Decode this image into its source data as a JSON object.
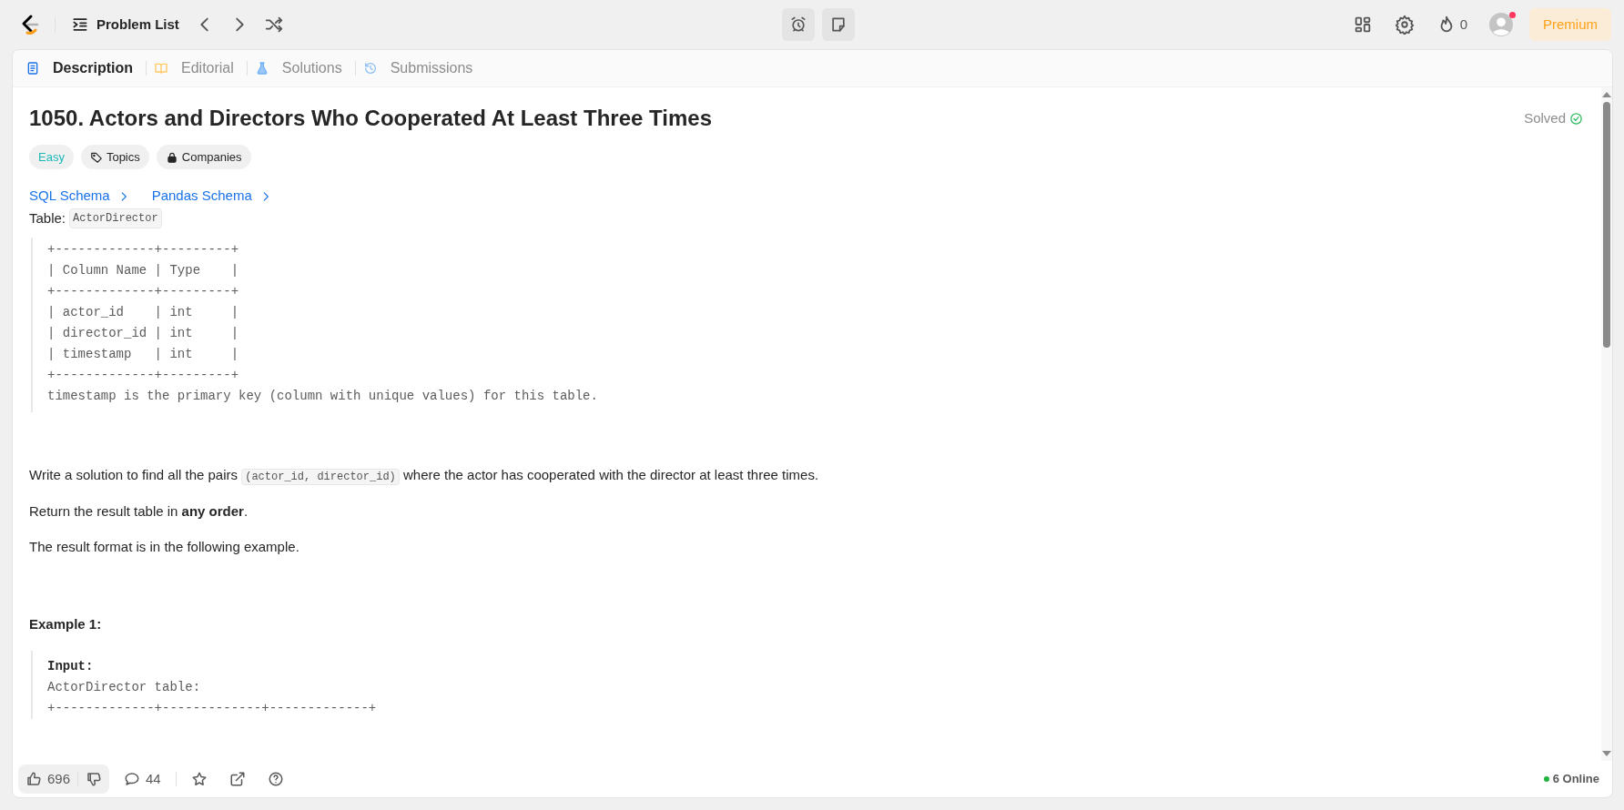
{
  "top_bar": {
    "problem_list": "Problem List",
    "streak": "0",
    "premium": "Premium",
    "notification_dot": true
  },
  "tabs": [
    {
      "label": "Description",
      "selected": true,
      "kind": "document"
    },
    {
      "label": "Editorial",
      "selected": false,
      "kind": "book"
    },
    {
      "label": "Solutions",
      "selected": false,
      "kind": "flask"
    },
    {
      "label": "Submissions",
      "selected": false,
      "kind": "history"
    }
  ],
  "problem": {
    "title": "1050. Actors and Directors Who Cooperated At Least Three Times",
    "status": "Solved",
    "difficulty": "Easy",
    "tags": [
      {
        "label": "Topics",
        "kind": "tag"
      },
      {
        "label": "Companies",
        "kind": "lock"
      }
    ],
    "schema_links": [
      "SQL Schema",
      "Pandas Schema"
    ],
    "table_label": "Table:",
    "table_name": "ActorDirector",
    "schema_lines": [
      "+-------------+---------+",
      "| Column Name | Type    |",
      "+-------------+---------+",
      "| actor_id    | int     |",
      "| director_id | int     |",
      "| timestamp   | int     |",
      "+-------------+---------+",
      "timestamp is the primary key (column with unique values) for this table."
    ],
    "statement": [
      {
        "text": "Write a solution to find all the pairs ",
        "code": "(actor_id, director_id)",
        "after": " where the actor has cooperated with the director at least three times."
      },
      {
        "text": "Return the result table in **any order**."
      },
      {
        "text": "The result format is in the following example."
      }
    ],
    "example": {
      "heading": "Example 1:",
      "input_label": "Input:",
      "lines": [
        "ActorDirector table:",
        "+-------------+-------------+-------------+"
      ]
    }
  },
  "bottom_bar": {
    "likes": "696",
    "comments": "44",
    "online": "6 Online"
  }
}
